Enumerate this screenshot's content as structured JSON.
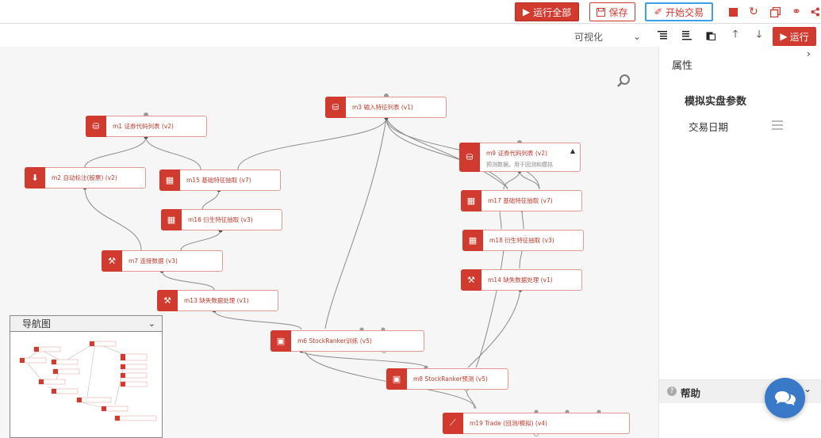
{
  "toolbar": {
    "run_all_label": "运行全部",
    "save_label": "保存",
    "start_trade_label": "开始交易"
  },
  "subbar": {
    "view_mode": "可视化",
    "run_label": "运行"
  },
  "nodes": {
    "m1": "m1 证券代码列表 (v2)",
    "m2": "m2 自动标注(股票) (v2)",
    "m3": "m3 输入特征列表 (v1)",
    "m15": "m15 基础特征抽取 (v7)",
    "m16": "m16 衍生特征抽取 (v3)",
    "m7": "m7 连接数据 (v3)",
    "m13": "m13 缺失数据处理 (v1)",
    "m9": "m9 证券代码列表 (v2)",
    "m9_sub": "预测数据，用于回测和模拟",
    "m17": "m17 基础特征抽取 (v7)",
    "m18": "m18 衍生特征抽取 (v3)",
    "m14": "m14 缺失数据处理 (v1)",
    "m6": "m6 StockRanker训练 (v5)",
    "m8": "m8 StockRanker预测 (v5)",
    "m19": "m19 Trade (回测/模拟) (v4)"
  },
  "navigator": {
    "title": "导航图"
  },
  "panel": {
    "title": "属性",
    "section_title": "模拟实盘参数",
    "field_label": "交易日期",
    "help_label": "帮助"
  },
  "colors": {
    "accent": "#d13a2f",
    "highlight_border": "#3aa0e8",
    "chat": "#3a78c8"
  }
}
